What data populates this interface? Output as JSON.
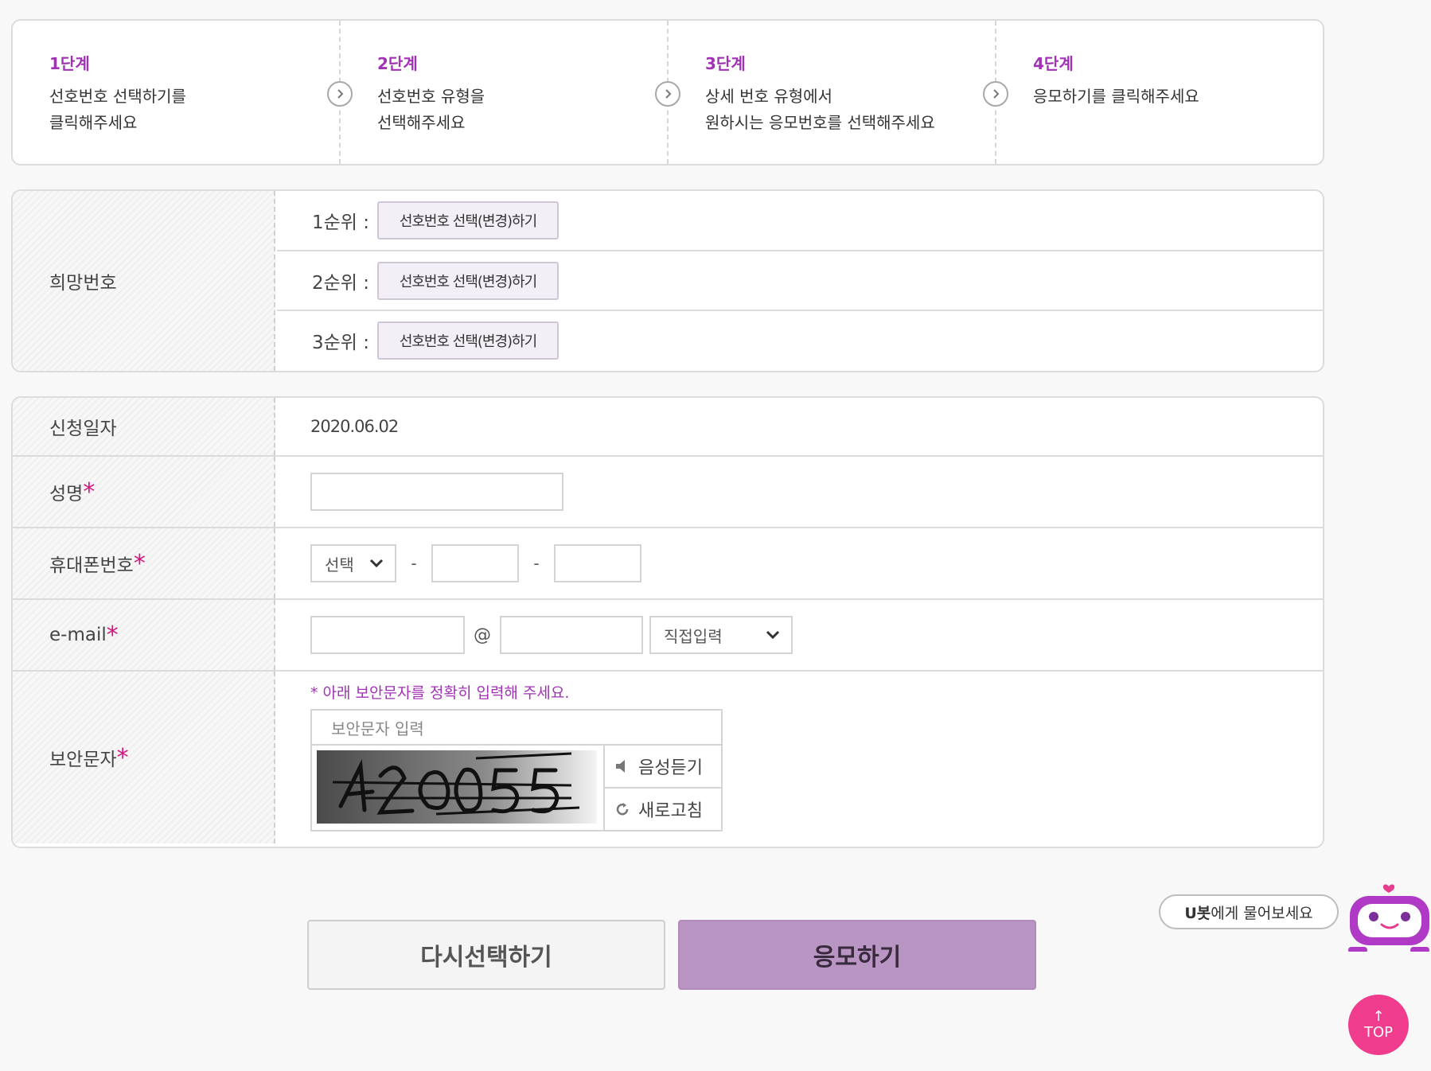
{
  "steps": [
    {
      "title": "1단계",
      "desc": "선호번호 선택하기를\n클릭해주세요"
    },
    {
      "title": "2단계",
      "desc": "선호번호 유형을\n선택해주세요"
    },
    {
      "title": "3단계",
      "desc": "상세 번호 유형에서\n원하시는 응모번호를 선택해주세요"
    },
    {
      "title": "4단계",
      "desc": "응모하기를 클릭해주세요"
    }
  ],
  "wish": {
    "label": "희망번호",
    "ranks": [
      {
        "label": "1순위 :",
        "button": "선호번호 선택(변경)하기"
      },
      {
        "label": "2순위 :",
        "button": "선호번호 선택(변경)하기"
      },
      {
        "label": "3순위 :",
        "button": "선호번호 선택(변경)하기"
      }
    ]
  },
  "form": {
    "date_label": "신청일자",
    "date_value": "2020.06.02",
    "name_label": "성명",
    "phone_label": "휴대폰번호",
    "phone_select": "선택",
    "phone_sep": "-",
    "email_label": "e-mail",
    "email_at": "@",
    "email_domain_select": "직접입력",
    "captcha_label": "보안문자",
    "required_mark": "*",
    "captcha_note": "* 아래 보안문자를 정확히 입력해 주세요.",
    "captcha_placeholder": "보안문자 입력",
    "captcha_listen": "음성듣기",
    "captcha_refresh": "새로고침"
  },
  "buttons": {
    "reset": "다시선택하기",
    "apply": "응모하기"
  },
  "chatbot": {
    "name": "U봇",
    "text": "에게 물어보세요"
  },
  "top_button": {
    "arrow": "↑",
    "label": "TOP"
  },
  "colors": {
    "accent_purple": "#a232b5",
    "required_pink": "#d4147e",
    "apply_button": "#b995c3",
    "top_button": "#ef3c8c"
  }
}
